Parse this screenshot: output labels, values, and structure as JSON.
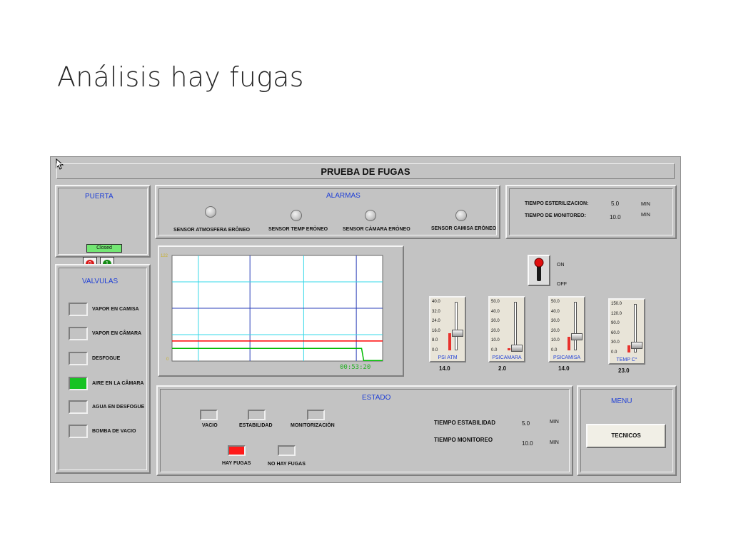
{
  "slide_title": "Análisis hay fugas",
  "header": {
    "title": "PRUEBA DE FUGAS"
  },
  "puerta": {
    "title": "PUERTA",
    "status": "Closed",
    "btn_open": "0",
    "btn_close": "1"
  },
  "alarmas": {
    "title": "ALARMAS",
    "items": [
      {
        "label": "SENSOR ATMOSFERA ERÒNEO"
      },
      {
        "label": "SENSOR TEMP ERÒNEO"
      },
      {
        "label": "SENSOR CÀMARA  ERÒNEO"
      },
      {
        "label": "SENSOR CAMISA ERÒNEO"
      }
    ]
  },
  "tiempos": {
    "esterilizacion_label": "TIEMPO ESTERILIZACION:",
    "esterilizacion_value": "5.0",
    "esterilizacion_unit": "MIN",
    "monitoreo_label": "TIEMPO DE MONITOREO:",
    "monitoreo_value": "10.0",
    "monitoreo_unit": "MIN"
  },
  "valvulas": {
    "title": "VALVULAS",
    "items": [
      {
        "label": "VAPOR EN CAMISA",
        "on": false
      },
      {
        "label": "VAPOR EN CÂMARA",
        "on": false
      },
      {
        "label": "DESFOGUE",
        "on": false
      },
      {
        "label": "AIRE EN LA CÂMARA",
        "on": true
      },
      {
        "label": "AGUA EN DESFOGUE",
        "on": false
      },
      {
        "label": "BOMBA DE VACIO",
        "on": false
      }
    ]
  },
  "trend": {
    "y_max_label": "122",
    "y_min_label": "0",
    "time_label": "00:53:20",
    "colors": {
      "red": "#ff0000",
      "green": "#00bb00",
      "grid_blue": "#2b3fb8",
      "grid_cyan": "#35d8e8"
    }
  },
  "switch": {
    "on_label": "ON",
    "off_label": "OFF"
  },
  "gauges": [
    {
      "caption": "PSI ATM",
      "ticks": [
        "40.0",
        "32.0",
        "24.0",
        "16.0",
        "8.0",
        "0.0"
      ],
      "max": 40,
      "value": 14.0,
      "value_label": "14.0"
    },
    {
      "caption": "PSICAMARA",
      "ticks": [
        "50.0",
        "40.0",
        "30.0",
        "20.0",
        "10.0",
        "0.0"
      ],
      "max": 50,
      "value": 2.0,
      "value_label": "2.0"
    },
    {
      "caption": "PSICAMISA",
      "ticks": [
        "50.0",
        "40.0",
        "30.0",
        "20.0",
        "10.0",
        "0.0"
      ],
      "max": 50,
      "value": 14.0,
      "value_label": "14.0"
    },
    {
      "caption": "TEMP C°",
      "ticks": [
        "150.0",
        "120.0",
        "90.0",
        "60.0",
        "30.0",
        "0.0"
      ],
      "max": 150,
      "value": 23.0,
      "value_label": "23.0"
    }
  ],
  "estado": {
    "title": "ESTADO",
    "indicators": [
      {
        "label": "VACIO",
        "on": false
      },
      {
        "label": "ESTABILIDAD",
        "on": false
      },
      {
        "label": "MONITORIZACIÒN",
        "on": false
      }
    ],
    "hay_fugas": {
      "label": "HAY FUGAS",
      "on": true
    },
    "no_hay_fugas": {
      "label": "NO HAY FUGAS",
      "on": false
    },
    "estabilidad_label": "TIEMPO ESTABILIDAD",
    "estabilidad_value": "5.0",
    "estabilidad_unit": "MIN",
    "monitoreo_label": "TIEMPO MONITOREO",
    "monitoreo_value": "10.0",
    "monitoreo_unit": "MIN"
  },
  "menu": {
    "title": "MENU",
    "tecnicos": "TECNICOS"
  }
}
